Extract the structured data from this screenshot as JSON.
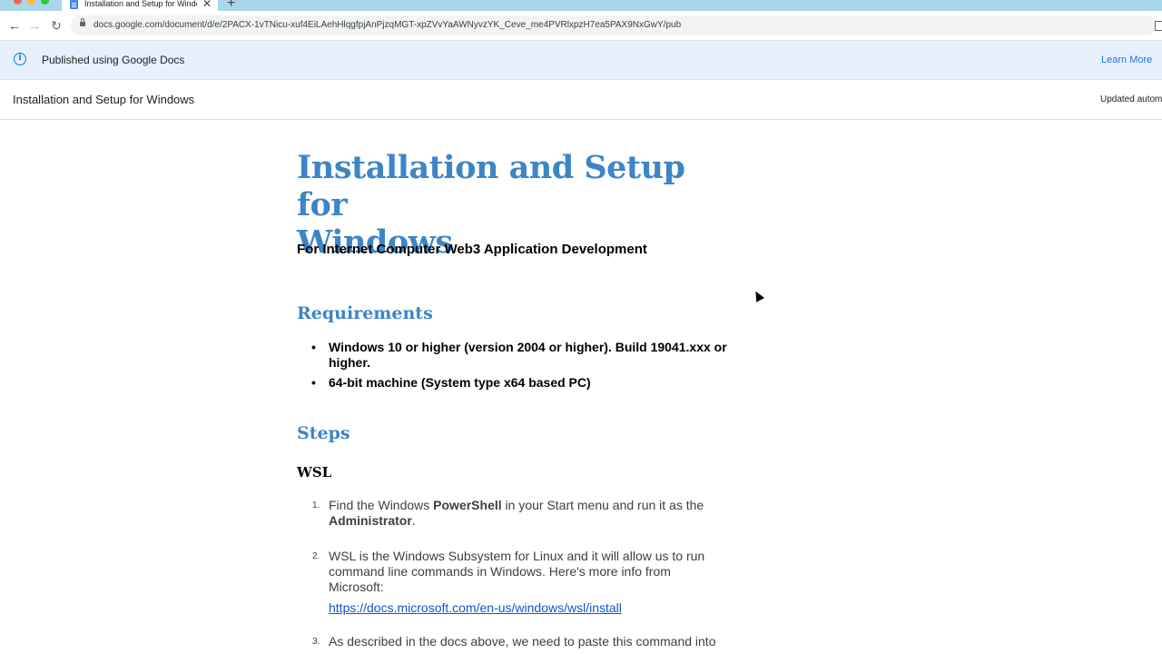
{
  "browser": {
    "tab_title": "Installation and Setup for Windows",
    "tab_close": "✕",
    "new_tab": "+",
    "url": "docs.google.com/document/d/e/2PACX-1vTNicu-xuf4EiLAehHlqgfpjAnPjzqMGT-xpZVvYaAWNyvzYK_Ceve_me4PVRlxpzH7ea5PAX9NxGwY/pub",
    "back": "←",
    "forward": "→",
    "reload": "↻"
  },
  "banner": {
    "text": "Published using Google Docs",
    "learn_more": "Learn More",
    "info_glyph": "i"
  },
  "doc_header": {
    "title": "Installation and Setup for Windows",
    "updated": "Updated automa"
  },
  "doc": {
    "title_line1": "Installation and Setup for",
    "title_line2": "Windows",
    "subtitle": "For Internet Computer Web3 Application Development",
    "requirements_heading": "Requirements",
    "requirements": [
      "Windows 10 or higher (version 2004 or higher). Build 19041.xxx or higher.",
      "64-bit machine (System type x64 based PC)"
    ],
    "steps_heading": "Steps",
    "wsl_heading": "WSL",
    "steps": [
      {
        "num": "1.",
        "before": "Find the Windows ",
        "bold1": "PowerShell",
        "middle": " in your Start menu and run it as the ",
        "bold2": "Administrator",
        "after": "."
      },
      {
        "num": "2.",
        "text": "WSL is the Windows Subsystem for Linux and it will allow us to run command line commands in Windows. Here's more info from Microsoft:",
        "link": "https://docs.microsoft.com/en-us/windows/wsl/install"
      },
      {
        "num": "3.",
        "text": "As described in the docs above, we need to paste this command into"
      }
    ]
  },
  "colors": {
    "heading_blue": "#3d85c6",
    "link_blue": "#1155cc",
    "banner_bg": "#e8f0fe",
    "tabbar_bg": "#a9d6e9"
  }
}
